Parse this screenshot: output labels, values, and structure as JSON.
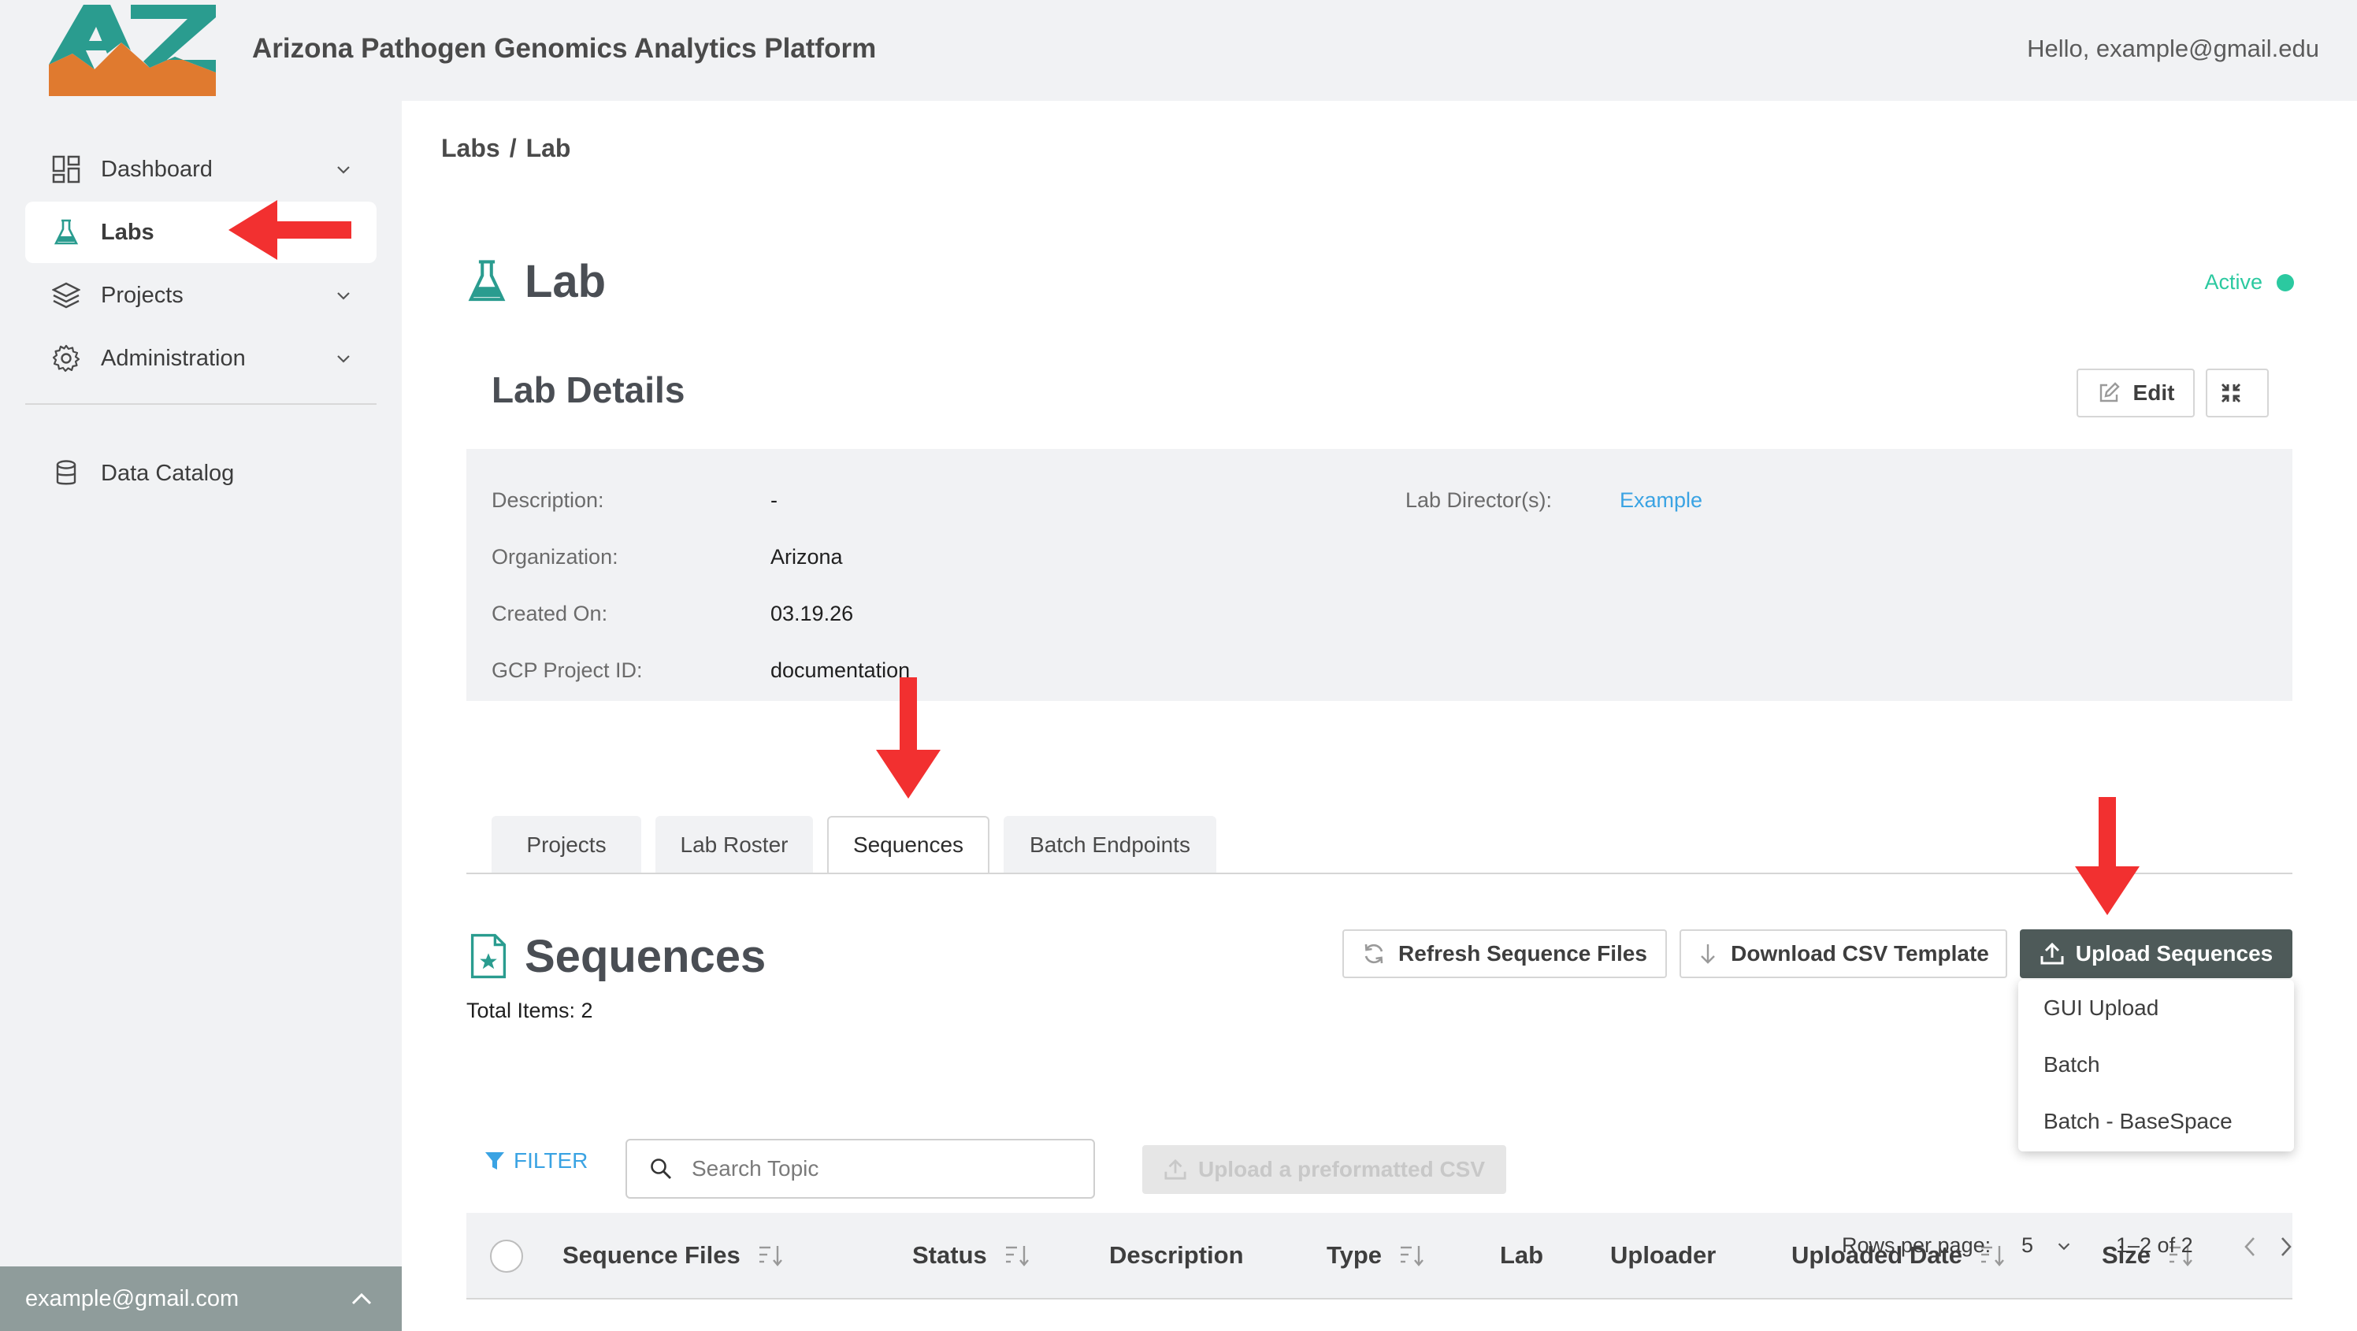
{
  "header": {
    "logo_text": "AZ",
    "app_title": "Arizona Pathogen Genomics Analytics Platform",
    "greeting": "Hello, example@gmail.edu"
  },
  "sidebar": {
    "items": [
      {
        "label": "Dashboard",
        "icon": "dashboard-icon",
        "has_chevron": true
      },
      {
        "label": "Labs",
        "icon": "flask-icon",
        "active": true
      },
      {
        "label": "Projects",
        "icon": "layers-icon",
        "has_chevron": true
      },
      {
        "label": "Administration",
        "icon": "gear-icon",
        "has_chevron": true
      },
      {
        "label": "Data Catalog",
        "icon": "database-icon"
      }
    ],
    "user_email": "example@gmail.com"
  },
  "breadcrumb": {
    "items": [
      "Labs",
      "Lab"
    ],
    "separator": "/"
  },
  "page": {
    "title": "Lab",
    "status": "Active",
    "status_color": "#2bc9a0"
  },
  "lab_details": {
    "title": "Lab Details",
    "edit_label": "Edit",
    "fields": {
      "description_label": "Description:",
      "description_value": "-",
      "organization_label": "Organization:",
      "organization_value": "Arizona",
      "created_label": "Created On:",
      "created_value": "03.19.26",
      "gcp_label": "GCP Project ID:",
      "gcp_value": "documentation",
      "director_label": "Lab Director(s):",
      "director_value": "Example"
    }
  },
  "tabs": [
    {
      "label": "Projects"
    },
    {
      "label": "Lab Roster"
    },
    {
      "label": "Sequences",
      "active": true
    },
    {
      "label": "Batch Endpoints"
    }
  ],
  "sequences": {
    "title": "Sequences",
    "total_items": "Total Items: 2",
    "refresh_label": "Refresh Sequence Files",
    "download_label": "Download CSV Template",
    "upload_label": "Upload Sequences",
    "filter_label": "FILTER",
    "search_placeholder": "Search Topic",
    "csv_upload_label": "Upload a preformatted CSV",
    "columns": [
      "Sequence Files",
      "Status",
      "Description",
      "Type",
      "Lab",
      "Uploader",
      "Uploaded Date",
      "Size"
    ],
    "upload_menu": [
      "GUI Upload",
      "Batch",
      "Batch - BaseSpace"
    ]
  },
  "pagination": {
    "rows_label": "Rows per page:",
    "rows_value": "5",
    "range": "1–2 of 2"
  },
  "colors": {
    "accent": "#2a9c8f",
    "annotation_red": "#f23030",
    "link": "#3aa3e3",
    "upload_button": "#4e5a59"
  }
}
